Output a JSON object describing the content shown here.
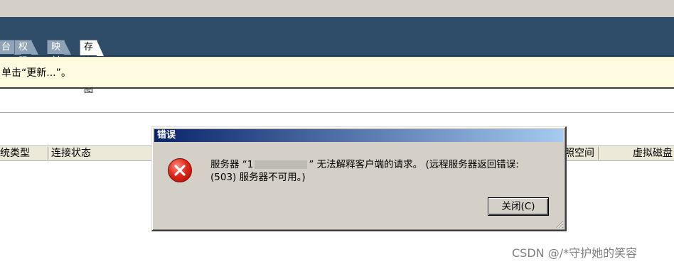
{
  "tabs": [
    {
      "label": "台"
    },
    {
      "label": "权限"
    },
    {
      "label": "映射"
    },
    {
      "label": "存储视图"
    }
  ],
  "infobar": {
    "text": "单击“更新...”。"
  },
  "columns": [
    {
      "label": "统类型"
    },
    {
      "label": "连接状态"
    },
    {
      "label": "照空间"
    },
    {
      "label": "虚拟磁盘"
    }
  ],
  "dialog": {
    "title": "错误",
    "icon": "error-icon",
    "message_part1": "服务器 “1",
    "message_part2": "” 无法解释客户端的请求。 (远程服务器返回错误:",
    "message_line2": "(503) 服务器不可用。)",
    "close_button": "关闭(C)"
  },
  "watermark": "CSDN @/*守护她的笑容"
}
